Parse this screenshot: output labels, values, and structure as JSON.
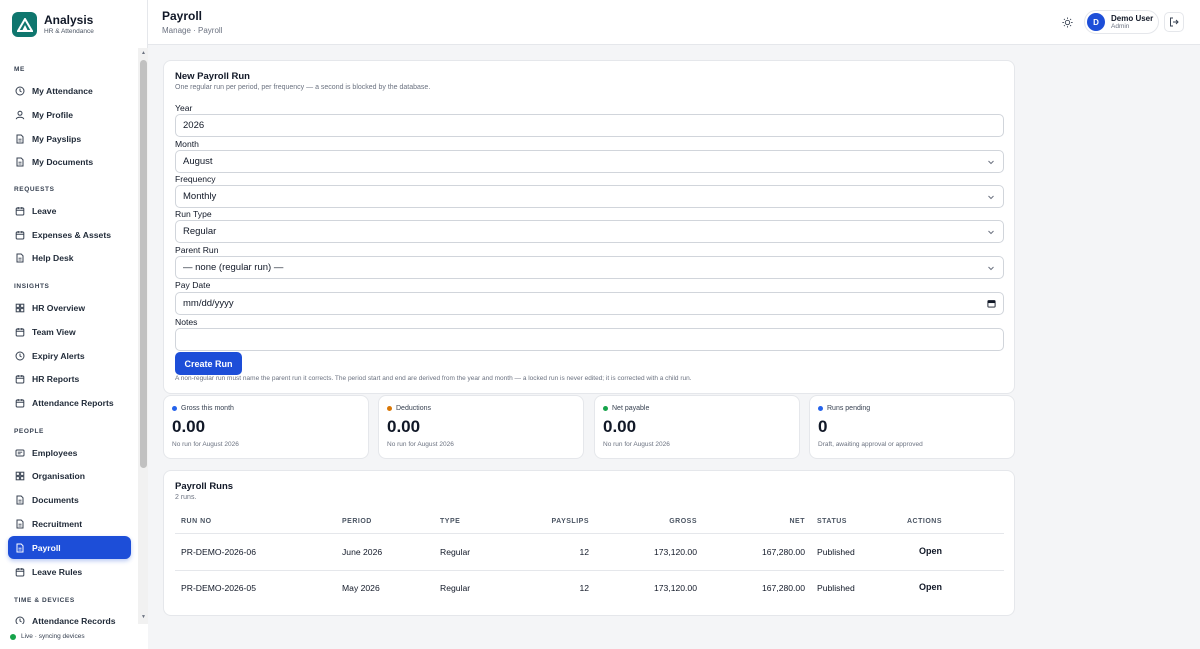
{
  "app": {
    "title": "Analysis",
    "subtitle": "HR & Attendance"
  },
  "sidebar": {
    "sections": [
      {
        "title": "ME",
        "items": [
          "My Attendance",
          "My Profile",
          "My Payslips",
          "My Documents"
        ]
      },
      {
        "title": "REQUESTS",
        "items": [
          "Leave",
          "Expenses & Assets",
          "Help Desk"
        ]
      },
      {
        "title": "INSIGHTS",
        "items": [
          "HR Overview",
          "Team View",
          "Expiry Alerts",
          "HR Reports",
          "Attendance Reports"
        ]
      },
      {
        "title": "PEOPLE",
        "items": [
          "Employees",
          "Organisation",
          "Documents",
          "Recruitment",
          "Payroll",
          "Leave Rules"
        ]
      },
      {
        "title": "TIME & DEVICES",
        "items": [
          "Attendance Records"
        ]
      }
    ],
    "active_item": "Payroll",
    "live_status": "Live · syncing devices"
  },
  "header": {
    "title": "Payroll",
    "breadcrumb": "Manage · Payroll",
    "user_name": "Demo User",
    "user_role": "Admin",
    "user_initial": "D"
  },
  "form": {
    "title": "New Payroll Run",
    "subtitle": "One regular run per period, per frequency — a second is blocked by the database.",
    "year_label": "Year",
    "year_value": "2026",
    "month_label": "Month",
    "month_value": "August",
    "frequency_label": "Frequency",
    "frequency_value": "Monthly",
    "run_type_label": "Run Type",
    "run_type_value": "Regular",
    "parent_run_label": "Parent Run",
    "parent_run_value": "— none (regular run) —",
    "pay_date_label": "Pay Date",
    "pay_date_placeholder": "mm/dd/yyyy",
    "notes_label": "Notes",
    "notes_value": "",
    "create_label": "Create Run",
    "hint": "A non-regular run must name the parent run it corrects. The period start and end are derived from the year and month — a locked run is never edited; it is corrected with a child run."
  },
  "stats": [
    {
      "label": "Gross this month",
      "value": "0.00",
      "note": "No run for August 2026",
      "color": "#2563eb"
    },
    {
      "label": "Deductions",
      "value": "0.00",
      "note": "No run for August 2026",
      "color": "#d97706"
    },
    {
      "label": "Net payable",
      "value": "0.00",
      "note": "No run for August 2026",
      "color": "#16a34a"
    },
    {
      "label": "Runs pending",
      "value": "0",
      "note": "Draft, awaiting approval or approved",
      "color": "#2563eb"
    }
  ],
  "runs": {
    "title": "Payroll Runs",
    "count": "2 runs.",
    "columns": [
      "RUN NO",
      "PERIOD",
      "TYPE",
      "PAYSLIPS",
      "GROSS",
      "NET",
      "STATUS",
      "ACTIONS"
    ],
    "rows": [
      {
        "run_no": "PR-DEMO-2026-06",
        "period": "June 2026",
        "type": "Regular",
        "payslips": "12",
        "gross": "173,120.00",
        "net": "167,280.00",
        "status": "Published",
        "action": "Open"
      },
      {
        "run_no": "PR-DEMO-2026-05",
        "period": "May 2026",
        "type": "Regular",
        "payslips": "12",
        "gross": "173,120.00",
        "net": "167,280.00",
        "status": "Published",
        "action": "Open"
      }
    ]
  },
  "colors": {
    "accent": "#1d4ed8",
    "brand": "#0f766e",
    "live": "#16a34a"
  }
}
